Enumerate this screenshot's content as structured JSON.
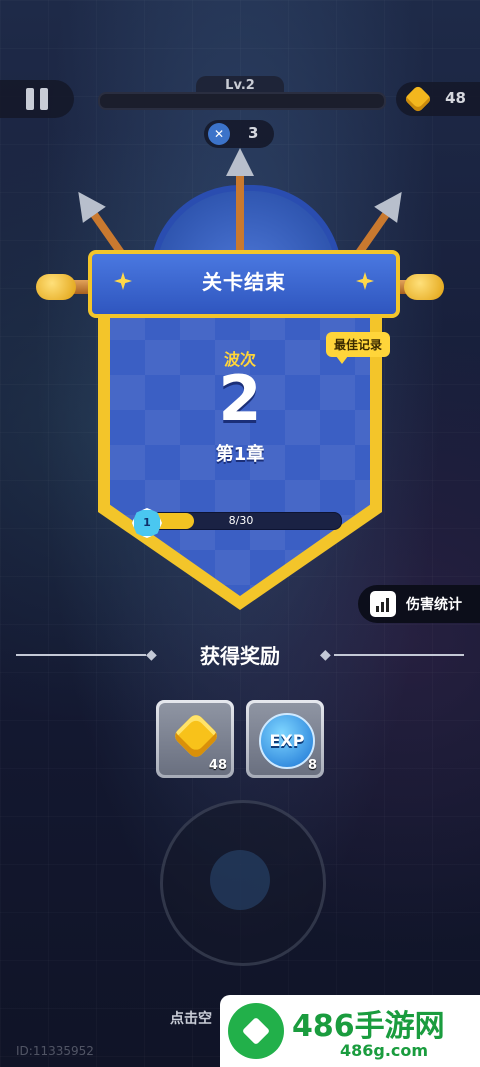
{
  "hud": {
    "level_label": "Lv.2",
    "level_progress": 0.0,
    "coins": "48",
    "swords": "3"
  },
  "panel": {
    "title": "关卡结束",
    "best_record": "最佳记录",
    "wave_label": "波次",
    "wave_value": "2",
    "chapter": "第1章",
    "progress_level": "1",
    "progress_text": "8/30",
    "progress_fraction": 0.267
  },
  "damage_stats_label": "伤害统计",
  "rewards": {
    "title": "获得奖励",
    "items": [
      {
        "icon": "gold-gem-icon",
        "count": "48"
      },
      {
        "icon": "exp-orb-icon",
        "label": "EXP",
        "count": "8"
      }
    ]
  },
  "footer": {
    "tap_text": "点击空",
    "uid_text": "ID:11335952"
  },
  "watermark": {
    "title": "486手游网",
    "sub": "486g.com"
  },
  "colors": {
    "accent_gold": "#f3c52a",
    "panel_blue": "#3b5fc4",
    "watermark_green": "#1a9c3e"
  }
}
